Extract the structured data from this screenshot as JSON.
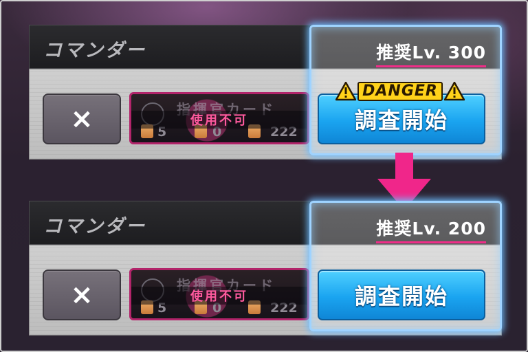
{
  "before": {
    "title": "コマンダー",
    "level_label": "推奨Lv. 300",
    "close_symbol": "×",
    "item_slot": {
      "ghost_label": "指揮官カード",
      "status": "使用不可",
      "counts": [
        "5",
        "0",
        "222"
      ]
    },
    "warning": {
      "label": "DANGER",
      "icon": "warning-icon"
    },
    "start_button": "調査開始"
  },
  "after": {
    "title": "コマンダー",
    "level_label": "推奨Lv. 200",
    "close_symbol": "×",
    "item_slot": {
      "ghost_label": "指揮官カード",
      "status": "使用不可",
      "counts": [
        "5",
        "0",
        "222"
      ]
    },
    "start_button": "調査開始"
  },
  "colors": {
    "accent_pink": "#ef2d88",
    "button_blue": "#1aa4f0",
    "highlight_glow": "#9fd3ff",
    "danger_yellow": "#ffd21a"
  },
  "arrow_icon": "arrow-down-icon"
}
